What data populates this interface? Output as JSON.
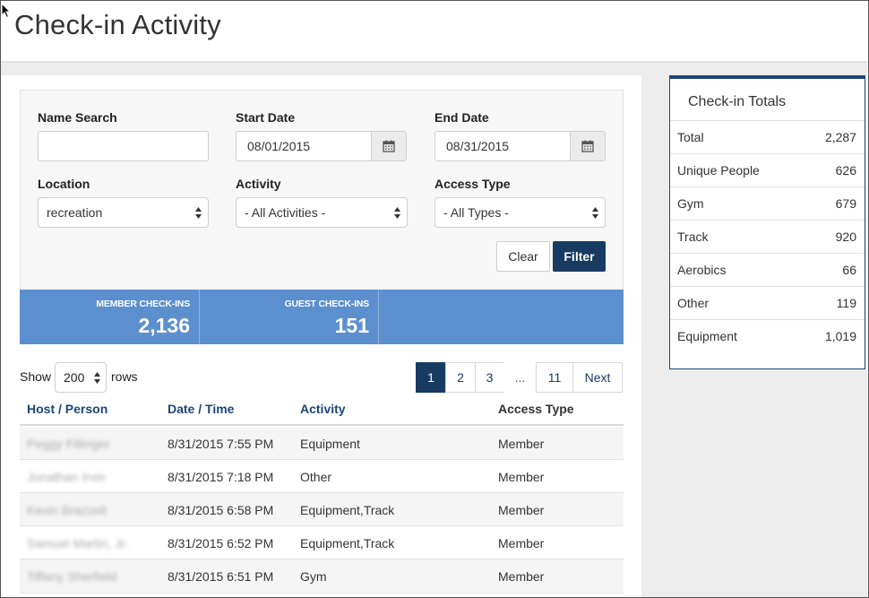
{
  "page": {
    "title": "Check-in Activity"
  },
  "filters": {
    "name_search": {
      "label": "Name Search",
      "value": ""
    },
    "start_date": {
      "label": "Start Date",
      "value": "08/01/2015"
    },
    "end_date": {
      "label": "End Date",
      "value": "08/31/2015"
    },
    "location": {
      "label": "Location",
      "value": "recreation"
    },
    "activity": {
      "label": "Activity",
      "value": "- All Activities -"
    },
    "access_type": {
      "label": "Access Type",
      "value": "- All Types -"
    },
    "clear_label": "Clear",
    "filter_label": "Filter"
  },
  "stats": [
    {
      "label": "MEMBER CHECK-INS",
      "value": "2,136"
    },
    {
      "label": "GUEST CHECK-INS",
      "value": "151"
    }
  ],
  "rows_control": {
    "show": "Show",
    "value": "200",
    "rows": "rows"
  },
  "pagination": {
    "pages": [
      "1",
      "2",
      "3",
      "...",
      "11"
    ],
    "next": "Next",
    "active": "1"
  },
  "table": {
    "columns": [
      "Host / Person",
      "Date / Time",
      "Activity",
      "Access Type"
    ],
    "rows": [
      {
        "person": "Peggy Fillinger",
        "datetime": "8/31/2015 7:55 PM",
        "activity": "Equipment",
        "access": "Member"
      },
      {
        "person": "Jonathan Irvin",
        "datetime": "8/31/2015 7:18 PM",
        "activity": "Other",
        "access": "Member"
      },
      {
        "person": "Kevin Brazzell",
        "datetime": "8/31/2015 6:58 PM",
        "activity": "Equipment,Track",
        "access": "Member"
      },
      {
        "person": "Samuel Martin, Jr.",
        "datetime": "8/31/2015 6:52 PM",
        "activity": "Equipment,Track",
        "access": "Member"
      },
      {
        "person": "Tiffany Sherfield",
        "datetime": "8/31/2015 6:51 PM",
        "activity": "Gym",
        "access": "Member"
      }
    ]
  },
  "totals": {
    "title": "Check-in Totals",
    "items": [
      {
        "label": "Total",
        "value": "2,287"
      },
      {
        "label": "Unique People",
        "value": "626"
      },
      {
        "label": "Gym",
        "value": "679"
      },
      {
        "label": "Track",
        "value": "920"
      },
      {
        "label": "Aerobics",
        "value": "66"
      },
      {
        "label": "Other",
        "value": "119"
      },
      {
        "label": "Equipment",
        "value": "1,019"
      }
    ]
  },
  "colors": {
    "accent_navy": "#183b62",
    "link_blue": "#1d4673",
    "stats_blue": "#5c8fcd"
  },
  "icons": {
    "calendar": "calendar-icon",
    "select_arrows": "select-arrows-icon",
    "cursor": "mouse-cursor-icon"
  }
}
